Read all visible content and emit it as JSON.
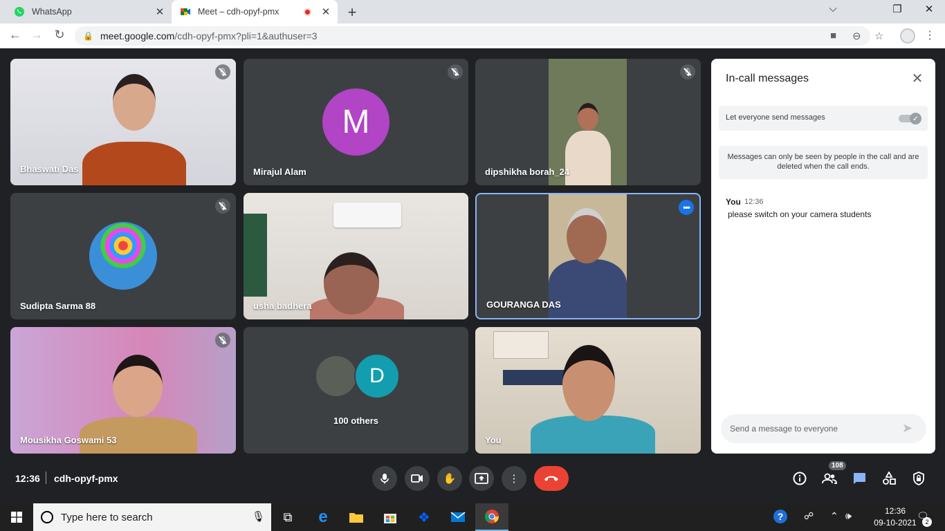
{
  "browser": {
    "tabs": [
      {
        "title": "WhatsApp",
        "close": "✕"
      },
      {
        "title": "Meet – cdh-opyf-pmx",
        "close": "✕"
      }
    ],
    "new_tab": "+",
    "window_controls": {
      "minimize": "⌵",
      "restore": "❐",
      "close": "✕"
    },
    "url_host": "meet.google.com",
    "url_rest": "/cdh-opyf-pmx?pli=1&authuser=3"
  },
  "participants": [
    {
      "name": "Bhaswati Das",
      "muted": true
    },
    {
      "name": "Mirajul Alam",
      "muted": true,
      "initial": "M",
      "avatar_color": "#b244c6"
    },
    {
      "name": "dipshikha borah_24",
      "muted": true
    },
    {
      "name": "Sudipta Sarma 88",
      "muted": true
    },
    {
      "name": "usha badhera",
      "muted": false
    },
    {
      "name": "GOURANGA DAS",
      "muted": false,
      "selected": true
    },
    {
      "name": "Mousikha Goswami 53",
      "muted": true
    },
    {
      "name": "100 others",
      "initial": "D",
      "avatar_color": "#129eaf"
    },
    {
      "name": "You",
      "muted": false
    }
  ],
  "chat": {
    "title": "In-call messages",
    "toggle_label": "Let everyone send messages",
    "toggle_on": true,
    "notice": "Messages can only be seen by people in the call and are deleted when the call ends.",
    "messages": [
      {
        "sender": "You",
        "time": "12:36",
        "text": "please switch on your camera students"
      }
    ],
    "input_placeholder": "Send a message to everyone"
  },
  "meeting": {
    "time": "12:36",
    "code": "cdh-opyf-pmx",
    "people_count": "108",
    "leave_color": "#ea4335"
  },
  "taskbar": {
    "search_placeholder": "Type here to search",
    "clock_time": "12:36",
    "clock_date": "09-10-2021",
    "notification_count": "2"
  }
}
